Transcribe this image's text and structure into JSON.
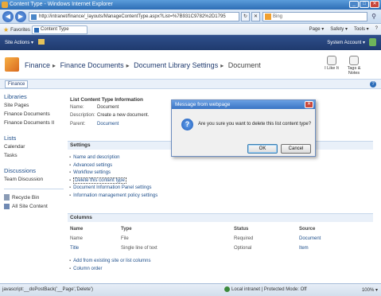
{
  "browser": {
    "title": "Content Type - Windows Internet Explorer",
    "url": "http://intranet/finance/_layouts/ManageContentType.aspx?List=%7B931C9782%2D1795",
    "search_placeholder": "Bing",
    "favorites_label": "Favorites",
    "tab_label": "Content Type",
    "tools": [
      "Page ▾",
      "Safety ▾",
      "Tools ▾",
      "?"
    ],
    "status_text": "javascript:__doPostBack('__Page','Delete')",
    "zone_text": "Local intranet | Protected Mode: Off",
    "zoom_text": "100% ▾"
  },
  "sitebar": {
    "site_actions": "Site Actions ▾",
    "account": "System Account ▾"
  },
  "breadcrumb": {
    "items": [
      "Finance",
      "Finance Documents",
      "Document Library Settings",
      "Document"
    ]
  },
  "ribbon": {
    "like_label": "I Like It",
    "tags_label": "Tags & Notes"
  },
  "topnav": {
    "item": "Finance"
  },
  "quicklaunch": {
    "libraries_head": "Libraries",
    "libraries": [
      "Site Pages",
      "Finance Documents",
      "Finance Documents II"
    ],
    "lists_head": "Lists",
    "lists": [
      "Calendar",
      "Tasks"
    ],
    "discussions_head": "Discussions",
    "discussions": [
      "Team Discussion"
    ],
    "recycle_bin": "Recycle Bin",
    "all_site_content": "All Site Content"
  },
  "content_type_info": {
    "heading": "List Content Type Information",
    "name_key": "Name:",
    "name_val": "Document",
    "desc_key": "Description:",
    "desc_val": "Create a new document.",
    "parent_key": "Parent:",
    "parent_val": "Document"
  },
  "settings": {
    "heading": "Settings",
    "links": [
      "Name and description",
      "Advanced settings",
      "Workflow settings",
      "Delete this content type",
      "Document Information Panel settings",
      "Information management policy settings"
    ]
  },
  "columns": {
    "heading": "Columns",
    "headers": [
      "Name",
      "Type",
      "Status",
      "Source"
    ],
    "rows": [
      [
        "Name",
        "File",
        "Required",
        "Document"
      ],
      [
        "Title",
        "Single line of text",
        "Optional",
        "Item"
      ]
    ],
    "links": [
      "Add from existing site or list columns",
      "Column order"
    ]
  },
  "dialog": {
    "title": "Message from webpage",
    "message": "Are you sure you want to delete this list content type?",
    "ok": "OK",
    "cancel": "Cancel"
  }
}
